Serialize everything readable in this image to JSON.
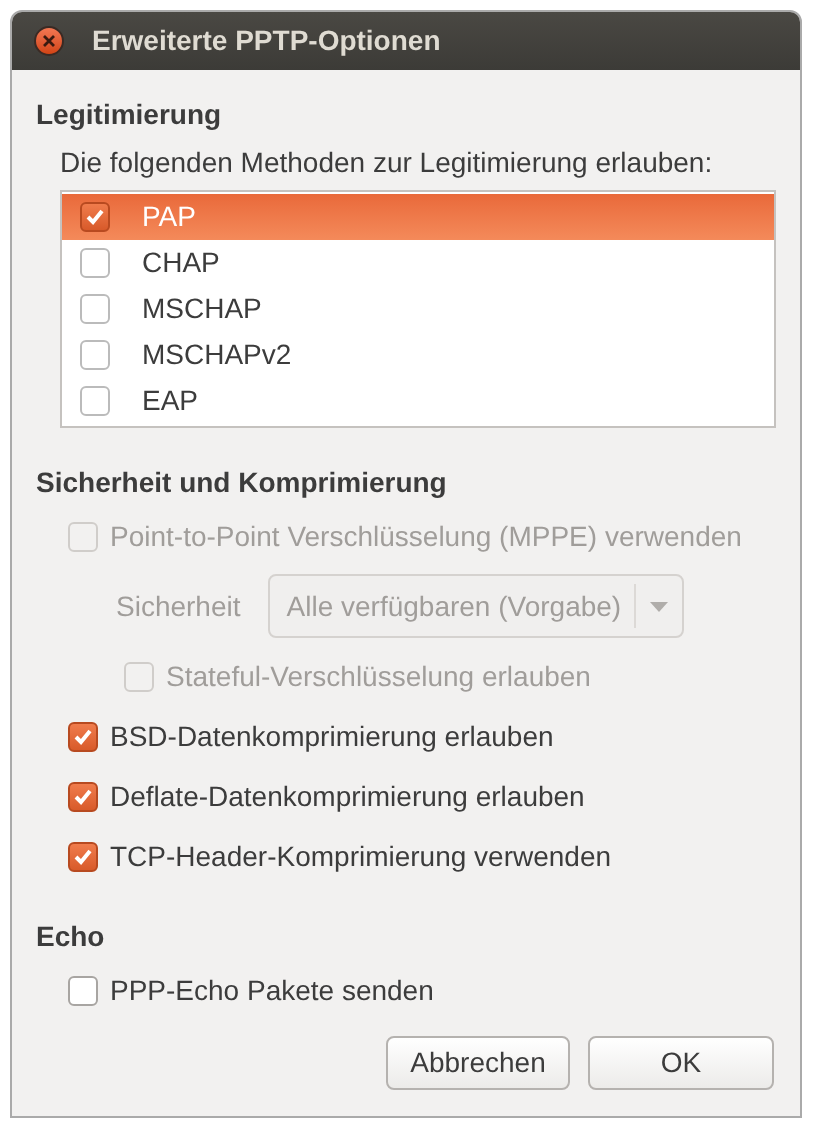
{
  "window": {
    "title": "Erweiterte PPTP-Optionen"
  },
  "authentication": {
    "heading": "Legitimierung",
    "description": "Die folgenden Methoden zur Legitimierung erlauben:",
    "methods": [
      {
        "label": "PAP",
        "checked": true,
        "selected": true
      },
      {
        "label": "CHAP",
        "checked": false,
        "selected": false
      },
      {
        "label": "MSCHAP",
        "checked": false,
        "selected": false
      },
      {
        "label": "MSCHAPv2",
        "checked": false,
        "selected": false
      },
      {
        "label": "EAP",
        "checked": false,
        "selected": false
      }
    ]
  },
  "security": {
    "heading": "Sicherheit und Komprimierung",
    "options": [
      {
        "kind": "checkbox",
        "label": "Point-to-Point Verschlüsselung (MPPE) verwenden",
        "checked": false,
        "disabled": true,
        "children": [
          {
            "kind": "select",
            "label": "Sicherheit",
            "value": "Alle verfügbaren (Vorgabe)",
            "disabled": true
          },
          {
            "kind": "checkbox",
            "label": "Stateful-Verschlüsselung erlauben",
            "checked": false,
            "disabled": true
          }
        ]
      },
      {
        "kind": "checkbox",
        "label": "BSD-Datenkomprimierung erlauben",
        "checked": true,
        "disabled": false
      },
      {
        "kind": "checkbox",
        "label": "Deflate-Datenkomprimierung erlauben",
        "checked": true,
        "disabled": false
      },
      {
        "kind": "checkbox",
        "label": "TCP-Header-Komprimierung verwenden",
        "checked": true,
        "disabled": false
      }
    ]
  },
  "echo": {
    "heading": "Echo",
    "options": [
      {
        "kind": "checkbox",
        "label": "PPP-Echo Pakete senden",
        "checked": false,
        "disabled": false
      }
    ]
  },
  "buttons": [
    "Abbrechen",
    "OK"
  ]
}
